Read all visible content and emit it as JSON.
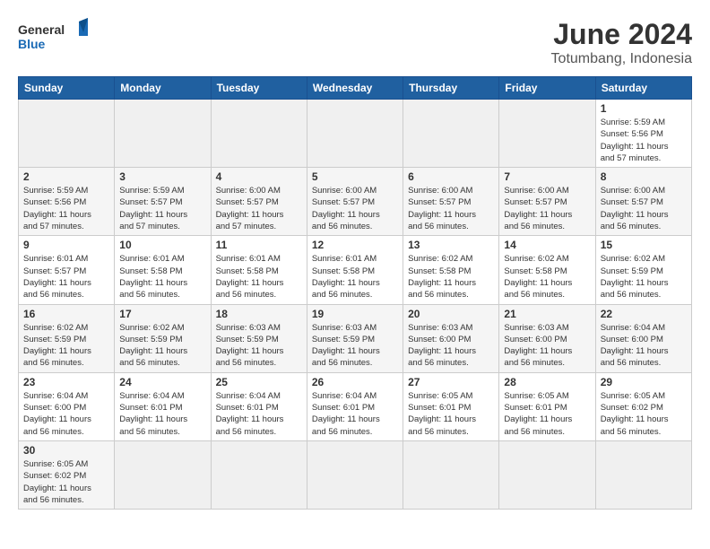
{
  "header": {
    "logo_general": "General",
    "logo_blue": "Blue",
    "month_title": "June 2024",
    "location": "Totumbang, Indonesia"
  },
  "weekdays": [
    "Sunday",
    "Monday",
    "Tuesday",
    "Wednesday",
    "Thursday",
    "Friday",
    "Saturday"
  ],
  "weeks": [
    [
      {
        "day": "",
        "info": ""
      },
      {
        "day": "",
        "info": ""
      },
      {
        "day": "",
        "info": ""
      },
      {
        "day": "",
        "info": ""
      },
      {
        "day": "",
        "info": ""
      },
      {
        "day": "",
        "info": ""
      },
      {
        "day": "1",
        "info": "Sunrise: 5:59 AM\nSunset: 5:56 PM\nDaylight: 11 hours\nand 57 minutes."
      }
    ],
    [
      {
        "day": "2",
        "info": "Sunrise: 5:59 AM\nSunset: 5:56 PM\nDaylight: 11 hours\nand 57 minutes."
      },
      {
        "day": "3",
        "info": "Sunrise: 5:59 AM\nSunset: 5:57 PM\nDaylight: 11 hours\nand 57 minutes."
      },
      {
        "day": "4",
        "info": "Sunrise: 6:00 AM\nSunset: 5:57 PM\nDaylight: 11 hours\nand 57 minutes."
      },
      {
        "day": "5",
        "info": "Sunrise: 6:00 AM\nSunset: 5:57 PM\nDaylight: 11 hours\nand 56 minutes."
      },
      {
        "day": "6",
        "info": "Sunrise: 6:00 AM\nSunset: 5:57 PM\nDaylight: 11 hours\nand 56 minutes."
      },
      {
        "day": "7",
        "info": "Sunrise: 6:00 AM\nSunset: 5:57 PM\nDaylight: 11 hours\nand 56 minutes."
      },
      {
        "day": "8",
        "info": "Sunrise: 6:00 AM\nSunset: 5:57 PM\nDaylight: 11 hours\nand 56 minutes."
      }
    ],
    [
      {
        "day": "9",
        "info": "Sunrise: 6:01 AM\nSunset: 5:57 PM\nDaylight: 11 hours\nand 56 minutes."
      },
      {
        "day": "10",
        "info": "Sunrise: 6:01 AM\nSunset: 5:58 PM\nDaylight: 11 hours\nand 56 minutes."
      },
      {
        "day": "11",
        "info": "Sunrise: 6:01 AM\nSunset: 5:58 PM\nDaylight: 11 hours\nand 56 minutes."
      },
      {
        "day": "12",
        "info": "Sunrise: 6:01 AM\nSunset: 5:58 PM\nDaylight: 11 hours\nand 56 minutes."
      },
      {
        "day": "13",
        "info": "Sunrise: 6:02 AM\nSunset: 5:58 PM\nDaylight: 11 hours\nand 56 minutes."
      },
      {
        "day": "14",
        "info": "Sunrise: 6:02 AM\nSunset: 5:58 PM\nDaylight: 11 hours\nand 56 minutes."
      },
      {
        "day": "15",
        "info": "Sunrise: 6:02 AM\nSunset: 5:59 PM\nDaylight: 11 hours\nand 56 minutes."
      }
    ],
    [
      {
        "day": "16",
        "info": "Sunrise: 6:02 AM\nSunset: 5:59 PM\nDaylight: 11 hours\nand 56 minutes."
      },
      {
        "day": "17",
        "info": "Sunrise: 6:02 AM\nSunset: 5:59 PM\nDaylight: 11 hours\nand 56 minutes."
      },
      {
        "day": "18",
        "info": "Sunrise: 6:03 AM\nSunset: 5:59 PM\nDaylight: 11 hours\nand 56 minutes."
      },
      {
        "day": "19",
        "info": "Sunrise: 6:03 AM\nSunset: 5:59 PM\nDaylight: 11 hours\nand 56 minutes."
      },
      {
        "day": "20",
        "info": "Sunrise: 6:03 AM\nSunset: 6:00 PM\nDaylight: 11 hours\nand 56 minutes."
      },
      {
        "day": "21",
        "info": "Sunrise: 6:03 AM\nSunset: 6:00 PM\nDaylight: 11 hours\nand 56 minutes."
      },
      {
        "day": "22",
        "info": "Sunrise: 6:04 AM\nSunset: 6:00 PM\nDaylight: 11 hours\nand 56 minutes."
      }
    ],
    [
      {
        "day": "23",
        "info": "Sunrise: 6:04 AM\nSunset: 6:00 PM\nDaylight: 11 hours\nand 56 minutes."
      },
      {
        "day": "24",
        "info": "Sunrise: 6:04 AM\nSunset: 6:01 PM\nDaylight: 11 hours\nand 56 minutes."
      },
      {
        "day": "25",
        "info": "Sunrise: 6:04 AM\nSunset: 6:01 PM\nDaylight: 11 hours\nand 56 minutes."
      },
      {
        "day": "26",
        "info": "Sunrise: 6:04 AM\nSunset: 6:01 PM\nDaylight: 11 hours\nand 56 minutes."
      },
      {
        "day": "27",
        "info": "Sunrise: 6:05 AM\nSunset: 6:01 PM\nDaylight: 11 hours\nand 56 minutes."
      },
      {
        "day": "28",
        "info": "Sunrise: 6:05 AM\nSunset: 6:01 PM\nDaylight: 11 hours\nand 56 minutes."
      },
      {
        "day": "29",
        "info": "Sunrise: 6:05 AM\nSunset: 6:02 PM\nDaylight: 11 hours\nand 56 minutes."
      }
    ],
    [
      {
        "day": "30",
        "info": "Sunrise: 6:05 AM\nSunset: 6:02 PM\nDaylight: 11 hours\nand 56 minutes."
      },
      {
        "day": "",
        "info": ""
      },
      {
        "day": "",
        "info": ""
      },
      {
        "day": "",
        "info": ""
      },
      {
        "day": "",
        "info": ""
      },
      {
        "day": "",
        "info": ""
      },
      {
        "day": "",
        "info": ""
      }
    ]
  ]
}
